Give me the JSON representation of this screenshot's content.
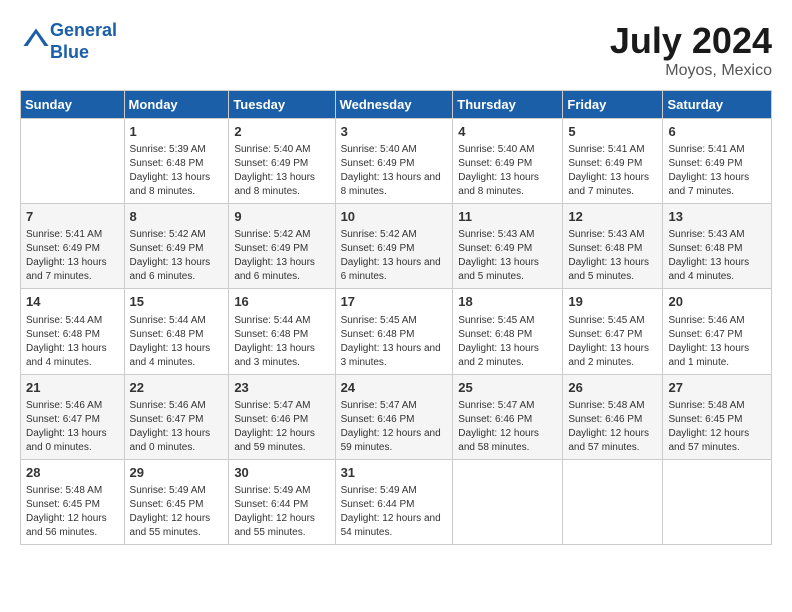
{
  "header": {
    "logo_line1": "General",
    "logo_line2": "Blue",
    "month_title": "July 2024",
    "location": "Moyos, Mexico"
  },
  "days_of_week": [
    "Sunday",
    "Monday",
    "Tuesday",
    "Wednesday",
    "Thursday",
    "Friday",
    "Saturday"
  ],
  "weeks": [
    [
      {
        "day": "",
        "sunrise": "",
        "sunset": "",
        "daylight": ""
      },
      {
        "day": "1",
        "sunrise": "Sunrise: 5:39 AM",
        "sunset": "Sunset: 6:48 PM",
        "daylight": "Daylight: 13 hours and 8 minutes."
      },
      {
        "day": "2",
        "sunrise": "Sunrise: 5:40 AM",
        "sunset": "Sunset: 6:49 PM",
        "daylight": "Daylight: 13 hours and 8 minutes."
      },
      {
        "day": "3",
        "sunrise": "Sunrise: 5:40 AM",
        "sunset": "Sunset: 6:49 PM",
        "daylight": "Daylight: 13 hours and 8 minutes."
      },
      {
        "day": "4",
        "sunrise": "Sunrise: 5:40 AM",
        "sunset": "Sunset: 6:49 PM",
        "daylight": "Daylight: 13 hours and 8 minutes."
      },
      {
        "day": "5",
        "sunrise": "Sunrise: 5:41 AM",
        "sunset": "Sunset: 6:49 PM",
        "daylight": "Daylight: 13 hours and 7 minutes."
      },
      {
        "day": "6",
        "sunrise": "Sunrise: 5:41 AM",
        "sunset": "Sunset: 6:49 PM",
        "daylight": "Daylight: 13 hours and 7 minutes."
      }
    ],
    [
      {
        "day": "7",
        "sunrise": "Sunrise: 5:41 AM",
        "sunset": "Sunset: 6:49 PM",
        "daylight": "Daylight: 13 hours and 7 minutes."
      },
      {
        "day": "8",
        "sunrise": "Sunrise: 5:42 AM",
        "sunset": "Sunset: 6:49 PM",
        "daylight": "Daylight: 13 hours and 6 minutes."
      },
      {
        "day": "9",
        "sunrise": "Sunrise: 5:42 AM",
        "sunset": "Sunset: 6:49 PM",
        "daylight": "Daylight: 13 hours and 6 minutes."
      },
      {
        "day": "10",
        "sunrise": "Sunrise: 5:42 AM",
        "sunset": "Sunset: 6:49 PM",
        "daylight": "Daylight: 13 hours and 6 minutes."
      },
      {
        "day": "11",
        "sunrise": "Sunrise: 5:43 AM",
        "sunset": "Sunset: 6:49 PM",
        "daylight": "Daylight: 13 hours and 5 minutes."
      },
      {
        "day": "12",
        "sunrise": "Sunrise: 5:43 AM",
        "sunset": "Sunset: 6:48 PM",
        "daylight": "Daylight: 13 hours and 5 minutes."
      },
      {
        "day": "13",
        "sunrise": "Sunrise: 5:43 AM",
        "sunset": "Sunset: 6:48 PM",
        "daylight": "Daylight: 13 hours and 4 minutes."
      }
    ],
    [
      {
        "day": "14",
        "sunrise": "Sunrise: 5:44 AM",
        "sunset": "Sunset: 6:48 PM",
        "daylight": "Daylight: 13 hours and 4 minutes."
      },
      {
        "day": "15",
        "sunrise": "Sunrise: 5:44 AM",
        "sunset": "Sunset: 6:48 PM",
        "daylight": "Daylight: 13 hours and 4 minutes."
      },
      {
        "day": "16",
        "sunrise": "Sunrise: 5:44 AM",
        "sunset": "Sunset: 6:48 PM",
        "daylight": "Daylight: 13 hours and 3 minutes."
      },
      {
        "day": "17",
        "sunrise": "Sunrise: 5:45 AM",
        "sunset": "Sunset: 6:48 PM",
        "daylight": "Daylight: 13 hours and 3 minutes."
      },
      {
        "day": "18",
        "sunrise": "Sunrise: 5:45 AM",
        "sunset": "Sunset: 6:48 PM",
        "daylight": "Daylight: 13 hours and 2 minutes."
      },
      {
        "day": "19",
        "sunrise": "Sunrise: 5:45 AM",
        "sunset": "Sunset: 6:47 PM",
        "daylight": "Daylight: 13 hours and 2 minutes."
      },
      {
        "day": "20",
        "sunrise": "Sunrise: 5:46 AM",
        "sunset": "Sunset: 6:47 PM",
        "daylight": "Daylight: 13 hours and 1 minute."
      }
    ],
    [
      {
        "day": "21",
        "sunrise": "Sunrise: 5:46 AM",
        "sunset": "Sunset: 6:47 PM",
        "daylight": "Daylight: 13 hours and 0 minutes."
      },
      {
        "day": "22",
        "sunrise": "Sunrise: 5:46 AM",
        "sunset": "Sunset: 6:47 PM",
        "daylight": "Daylight: 13 hours and 0 minutes."
      },
      {
        "day": "23",
        "sunrise": "Sunrise: 5:47 AM",
        "sunset": "Sunset: 6:46 PM",
        "daylight": "Daylight: 12 hours and 59 minutes."
      },
      {
        "day": "24",
        "sunrise": "Sunrise: 5:47 AM",
        "sunset": "Sunset: 6:46 PM",
        "daylight": "Daylight: 12 hours and 59 minutes."
      },
      {
        "day": "25",
        "sunrise": "Sunrise: 5:47 AM",
        "sunset": "Sunset: 6:46 PM",
        "daylight": "Daylight: 12 hours and 58 minutes."
      },
      {
        "day": "26",
        "sunrise": "Sunrise: 5:48 AM",
        "sunset": "Sunset: 6:46 PM",
        "daylight": "Daylight: 12 hours and 57 minutes."
      },
      {
        "day": "27",
        "sunrise": "Sunrise: 5:48 AM",
        "sunset": "Sunset: 6:45 PM",
        "daylight": "Daylight: 12 hours and 57 minutes."
      }
    ],
    [
      {
        "day": "28",
        "sunrise": "Sunrise: 5:48 AM",
        "sunset": "Sunset: 6:45 PM",
        "daylight": "Daylight: 12 hours and 56 minutes."
      },
      {
        "day": "29",
        "sunrise": "Sunrise: 5:49 AM",
        "sunset": "Sunset: 6:45 PM",
        "daylight": "Daylight: 12 hours and 55 minutes."
      },
      {
        "day": "30",
        "sunrise": "Sunrise: 5:49 AM",
        "sunset": "Sunset: 6:44 PM",
        "daylight": "Daylight: 12 hours and 55 minutes."
      },
      {
        "day": "31",
        "sunrise": "Sunrise: 5:49 AM",
        "sunset": "Sunset: 6:44 PM",
        "daylight": "Daylight: 12 hours and 54 minutes."
      },
      {
        "day": "",
        "sunrise": "",
        "sunset": "",
        "daylight": ""
      },
      {
        "day": "",
        "sunrise": "",
        "sunset": "",
        "daylight": ""
      },
      {
        "day": "",
        "sunrise": "",
        "sunset": "",
        "daylight": ""
      }
    ]
  ]
}
